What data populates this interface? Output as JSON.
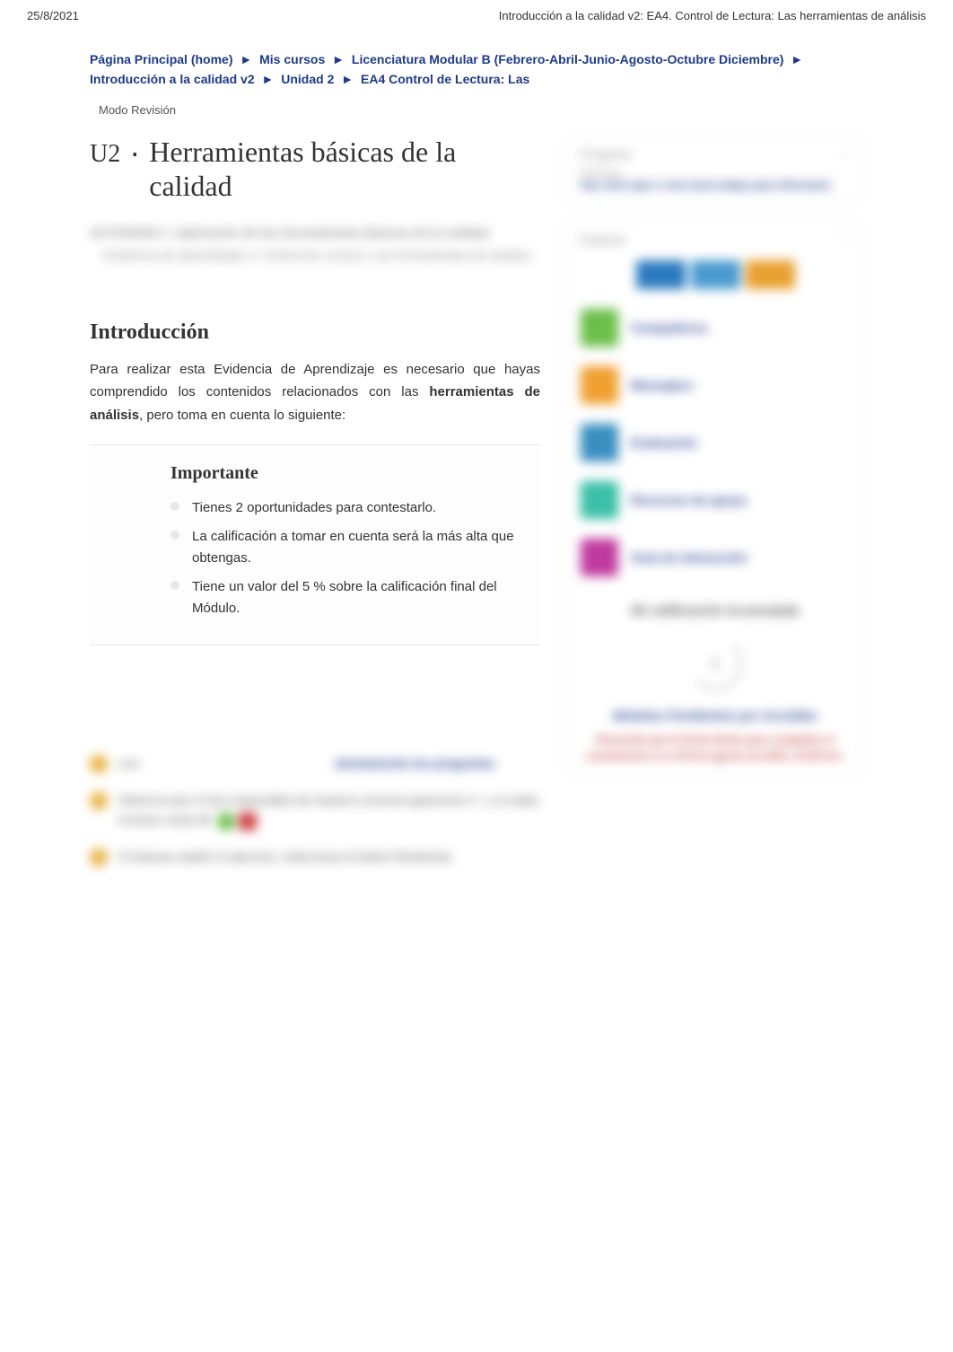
{
  "header": {
    "date": "25/8/2021",
    "title": "Introducción a la calidad v2: EA4. Control de Lectura: Las herramientas de análisis"
  },
  "breadcrumbs": {
    "home": "Página Principal (home)",
    "courses": "Mis cursos",
    "program": "Licenciatura Modular B (Febrero-Abril-Junio-Agosto-Octubre Diciembre)",
    "course": "Introducción a la calidad v2",
    "unit": "Unidad 2",
    "activity": "EA4 Control de Lectura: Las"
  },
  "mode": "Modo Revisión",
  "unit": {
    "badge": "U2",
    "title": "Herramientas básicas de la calidad"
  },
  "blurred_activity": {
    "line1": "ACTIVIDAD 1. Aplicación de las herramientas básicas de la calidad",
    "line2": "Evidencia de aprendizaje 4. Control de Lectura: Las herramientas de análisis"
  },
  "intro": {
    "heading": "Introducción",
    "p1_a": "Para realizar esta Evidencia de Aprendizaje es necesario que hayas comprendido los contenidos relacionados con las ",
    "p1_b": "herramientas de análisis",
    "p1_c": ", pero toma en cuenta lo siguiente:"
  },
  "important": {
    "title": "Importante",
    "items": [
      "Tienes 2 oportunidades para contestarlo.",
      "La calificación a tomar en cuenta será la más alta que obtengas.",
      "Tiene un valor del 5 % sobre la calificación final del Módulo."
    ]
  },
  "sidebar": {
    "progress_label": "Progreso",
    "progress_sub": "Módulos",
    "progress_link": "Haz click aquí o mira hacia abajo para informarte",
    "nav_label": "Enlaces",
    "nav_items": [
      "Compañeros",
      "Mensajero",
      "Evaluación",
      "Recursos de apoyo",
      "Guía de interacción"
    ],
    "grade_title": "Mi calificación Acumulada",
    "pending": "Módulos Pendientes por Acreditar",
    "deadline": "Recuerda que la fecha límite para completar el cuestionario es el 30 de agosto de 2021, 23:59 hrs."
  },
  "instructions": {
    "row1_left": "Lee",
    "row1_right": "atentamente las preguntas.",
    "row2": "Observa que si has respondido de manera correcta aparecerá ✔, y si estás erróneo verás ✘.",
    "row3": "Si deseas repetir el ejercicio, selecciona el botón Reintentar."
  }
}
